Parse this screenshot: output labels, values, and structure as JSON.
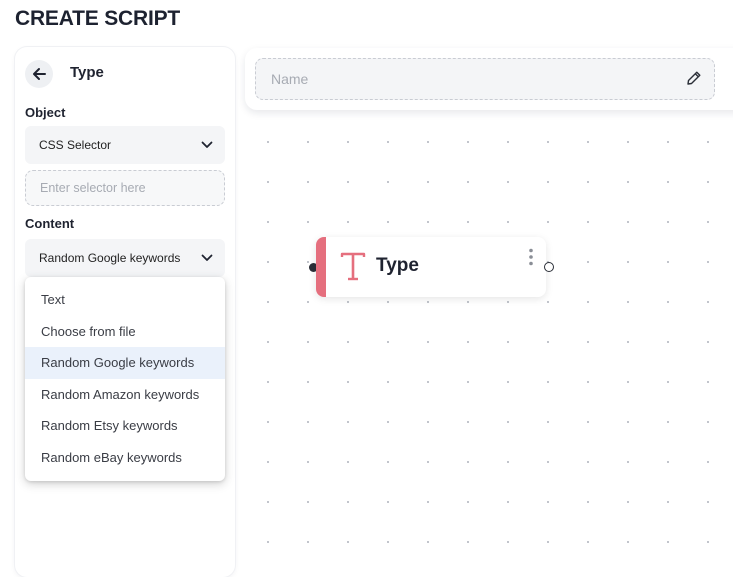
{
  "page": {
    "title": "CREATE SCRIPT"
  },
  "left_panel": {
    "back_icon": "arrow-left-icon",
    "title": "Type",
    "object_label": "Object",
    "object_select": {
      "value": "CSS Selector",
      "icon": "chevron-down-icon"
    },
    "selector_input": {
      "value": "",
      "placeholder": "Enter selector here"
    },
    "content_label": "Content",
    "content_select": {
      "value": "Random Google keywords",
      "icon": "chevron-down-icon"
    }
  },
  "dropdown": {
    "items": [
      {
        "label": "Text"
      },
      {
        "label": "Choose from file"
      },
      {
        "label": "Random Google keywords",
        "selected": true
      },
      {
        "label": "Random Amazon keywords"
      },
      {
        "label": "Random Etsy keywords"
      },
      {
        "label": "Random eBay keywords"
      }
    ],
    "selected_bg": "#eaf1fb"
  },
  "header": {
    "name_input": {
      "value": "",
      "placeholder": "Name"
    },
    "edit_icon": "pencil-icon"
  },
  "canvas": {
    "node": {
      "title": "Type",
      "icon": "text-type-icon",
      "accent_color": "#e56f7e",
      "menu_icon": "vertical-dots-icon"
    }
  },
  "colors": {
    "accent": "#e56f7e",
    "text": "#1f2330",
    "muted": "#a7abb3"
  }
}
